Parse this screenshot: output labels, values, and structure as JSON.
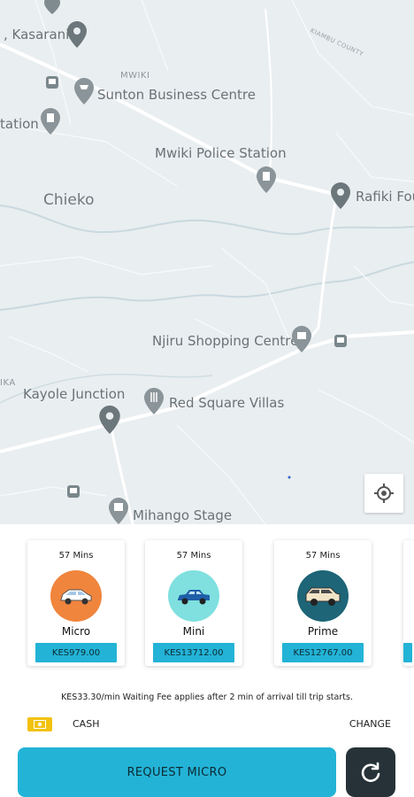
{
  "map": {
    "labels": {
      "kasarani": ", Kasarani",
      "mwiki": "MWIKI",
      "sunton": "Sunton Business Centre",
      "station": "tation",
      "police": "Mwiki Police Station",
      "chieko": "Chieko",
      "rafiki": "Rafiki Fou",
      "kiambu": "KIAMBU COUNTY",
      "njiru": "Njiru Shopping Centre",
      "ika": "IKA",
      "kayole": "Kayole Junction",
      "redsquare": "Red Square Villas",
      "mihango": "Mihango Stage"
    }
  },
  "rides": [
    {
      "eta": "57 Mins",
      "name": "Micro",
      "price": "KES979.00",
      "color": "#f0853d"
    },
    {
      "eta": "57 Mins",
      "name": "Mini",
      "price": "KES13712.00",
      "color": "#7fe0df"
    },
    {
      "eta": "57 Mins",
      "name": "Prime",
      "price": "KES12767.00",
      "color": "#1d6577"
    }
  ],
  "fee_note": "KES33.30/min Waiting Fee applies after 2 min of arrival till trip starts.",
  "payment": {
    "method": "CASH",
    "change_label": "CHANGE"
  },
  "request_label": "REQUEST MICRO",
  "colors": {
    "accent": "#23b3d6",
    "dark": "#263238",
    "cash": "#f2c20f"
  }
}
